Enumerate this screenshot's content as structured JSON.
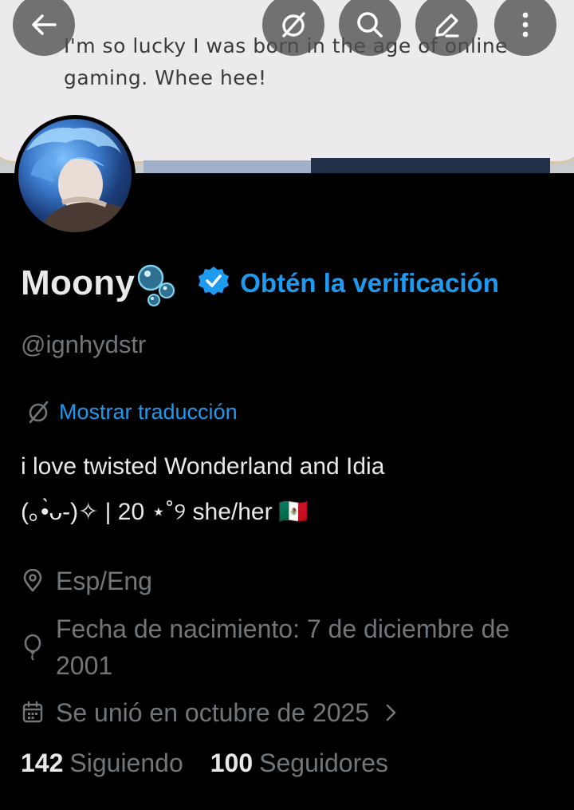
{
  "banner": {
    "text": "I'm so lucky I was born in the age of online gaming. Whee hee!"
  },
  "toolbar": {
    "back": "back-arrow-icon",
    "translate": "translate-icon",
    "search": "search-icon",
    "edit": "edit-pencil-icon",
    "more": "more-vertical-icon"
  },
  "profile": {
    "display_name": "Moony",
    "name_emoji": "🫧",
    "verify_cta": "Obtén la verificación",
    "handle": "@ignhydstr",
    "show_translation": "Mostrar traducción",
    "bio_line1": "i love twisted Wonderland and Idia",
    "bio_line2": "(｡•̀ᴗ-)✧ | 20 ⋆˚୨ she/her 🇲🇽",
    "location": "Esp/Eng",
    "birthday": "Fecha de nacimiento: 7 de diciembre de 2001",
    "joined": "Se unió en octubre de 2025"
  },
  "stats": {
    "following_count": "142",
    "following_label": "Siguiendo",
    "followers_count": "100",
    "followers_label": "Seguidores"
  },
  "colors": {
    "accent": "#1d9bf0",
    "text": "#e7e9ea",
    "muted": "#71767b",
    "background": "#000000"
  }
}
